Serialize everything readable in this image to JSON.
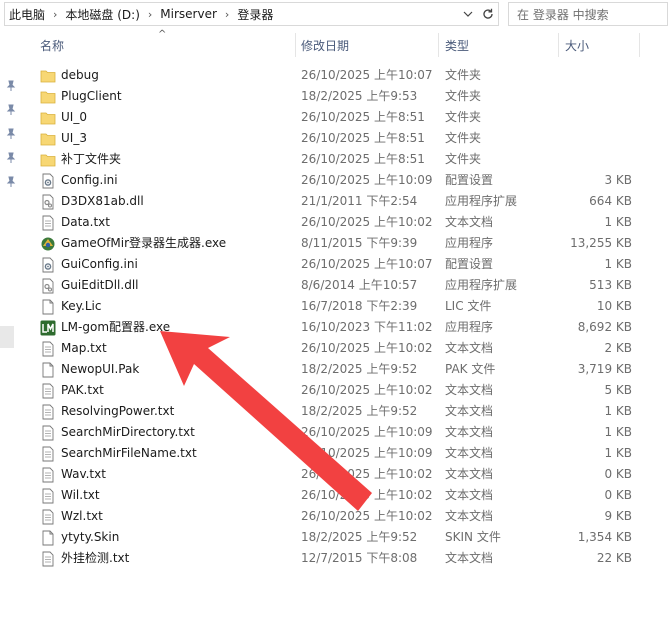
{
  "address": {
    "crumbs": [
      "此电脑",
      "本地磁盘 (D:)",
      "Mirserver",
      "登录器"
    ]
  },
  "search": {
    "placeholder": "在 登录器 中搜索"
  },
  "columns": {
    "name": "名称",
    "date": "修改日期",
    "type": "类型",
    "size": "大小"
  },
  "files": [
    {
      "name": "debug",
      "date": "26/10/2025 上午10:07",
      "type": "文件夹",
      "size": "",
      "icon": "folder-icon"
    },
    {
      "name": "PlugClient",
      "date": "18/2/2025 上午9:53",
      "type": "文件夹",
      "size": "",
      "icon": "folder-icon"
    },
    {
      "name": "UI_0",
      "date": "26/10/2025 上午8:51",
      "type": "文件夹",
      "size": "",
      "icon": "folder-icon"
    },
    {
      "name": "UI_3",
      "date": "26/10/2025 上午8:51",
      "type": "文件夹",
      "size": "",
      "icon": "folder-icon"
    },
    {
      "name": "补丁文件夹",
      "date": "26/10/2025 上午8:51",
      "type": "文件夹",
      "size": "",
      "icon": "folder-icon"
    },
    {
      "name": "Config.ini",
      "date": "26/10/2025 上午10:09",
      "type": "配置设置",
      "size": "3 KB",
      "icon": "settings-file-icon"
    },
    {
      "name": "D3DX81ab.dll",
      "date": "21/1/2011 下午2:54",
      "type": "应用程序扩展",
      "size": "664 KB",
      "icon": "dll-file-icon"
    },
    {
      "name": "Data.txt",
      "date": "26/10/2025 上午10:02",
      "type": "文本文档",
      "size": "1 KB",
      "icon": "text-file-icon"
    },
    {
      "name": "GameOfMir登录器生成器.exe",
      "date": "8/11/2015 下午9:39",
      "type": "应用程序",
      "size": "13,255 KB",
      "icon": "app-exe-icon"
    },
    {
      "name": "GuiConfig.ini",
      "date": "26/10/2025 上午10:07",
      "type": "配置设置",
      "size": "1 KB",
      "icon": "settings-file-icon"
    },
    {
      "name": "GuiEditDll.dll",
      "date": "8/6/2014 上午10:57",
      "type": "应用程序扩展",
      "size": "513 KB",
      "icon": "dll-file-icon"
    },
    {
      "name": "Key.Lic",
      "date": "16/7/2018 下午2:39",
      "type": "LIC 文件",
      "size": "10 KB",
      "icon": "generic-file-icon"
    },
    {
      "name": "LM-gom配置器.exe",
      "date": "16/10/2023 下午11:02",
      "type": "应用程序",
      "size": "8,692 KB",
      "icon": "lm-app-icon"
    },
    {
      "name": "Map.txt",
      "date": "26/10/2025 上午10:02",
      "type": "文本文档",
      "size": "2 KB",
      "icon": "text-file-icon"
    },
    {
      "name": "NewopUI.Pak",
      "date": "18/2/2025 上午9:52",
      "type": "PAK 文件",
      "size": "3,719 KB",
      "icon": "generic-file-icon"
    },
    {
      "name": "PAK.txt",
      "date": "26/10/2025 上午10:02",
      "type": "文本文档",
      "size": "5 KB",
      "icon": "text-file-icon"
    },
    {
      "name": "ResolvingPower.txt",
      "date": "18/2/2025 上午9:52",
      "type": "文本文档",
      "size": "1 KB",
      "icon": "text-file-icon"
    },
    {
      "name": "SearchMirDirectory.txt",
      "date": "26/10/2025 上午10:09",
      "type": "文本文档",
      "size": "1 KB",
      "icon": "text-file-icon"
    },
    {
      "name": "SearchMirFileName.txt",
      "date": "26/10/2025 上午10:09",
      "type": "文本文档",
      "size": "1 KB",
      "icon": "text-file-icon"
    },
    {
      "name": "Wav.txt",
      "date": "26/10/2025 上午10:02",
      "type": "文本文档",
      "size": "0 KB",
      "icon": "text-file-icon"
    },
    {
      "name": "Wil.txt",
      "date": "26/10/2025 上午10:02",
      "type": "文本文档",
      "size": "0 KB",
      "icon": "text-file-icon"
    },
    {
      "name": "Wzl.txt",
      "date": "26/10/2025 上午10:02",
      "type": "文本文档",
      "size": "9 KB",
      "icon": "text-file-icon"
    },
    {
      "name": "ytyty.Skin",
      "date": "18/2/2025 上午9:52",
      "type": "SKIN 文件",
      "size": "1,354 KB",
      "icon": "generic-file-icon"
    },
    {
      "name": "外挂检测.txt",
      "date": "12/7/2015 下午8:08",
      "type": "文本文档",
      "size": "22 KB",
      "icon": "text-file-icon"
    }
  ],
  "colors": {
    "folder": "#f7d774",
    "arrow": "#f24141",
    "header_text": "#4a5a7a",
    "meta_text": "#6d6d6d"
  }
}
